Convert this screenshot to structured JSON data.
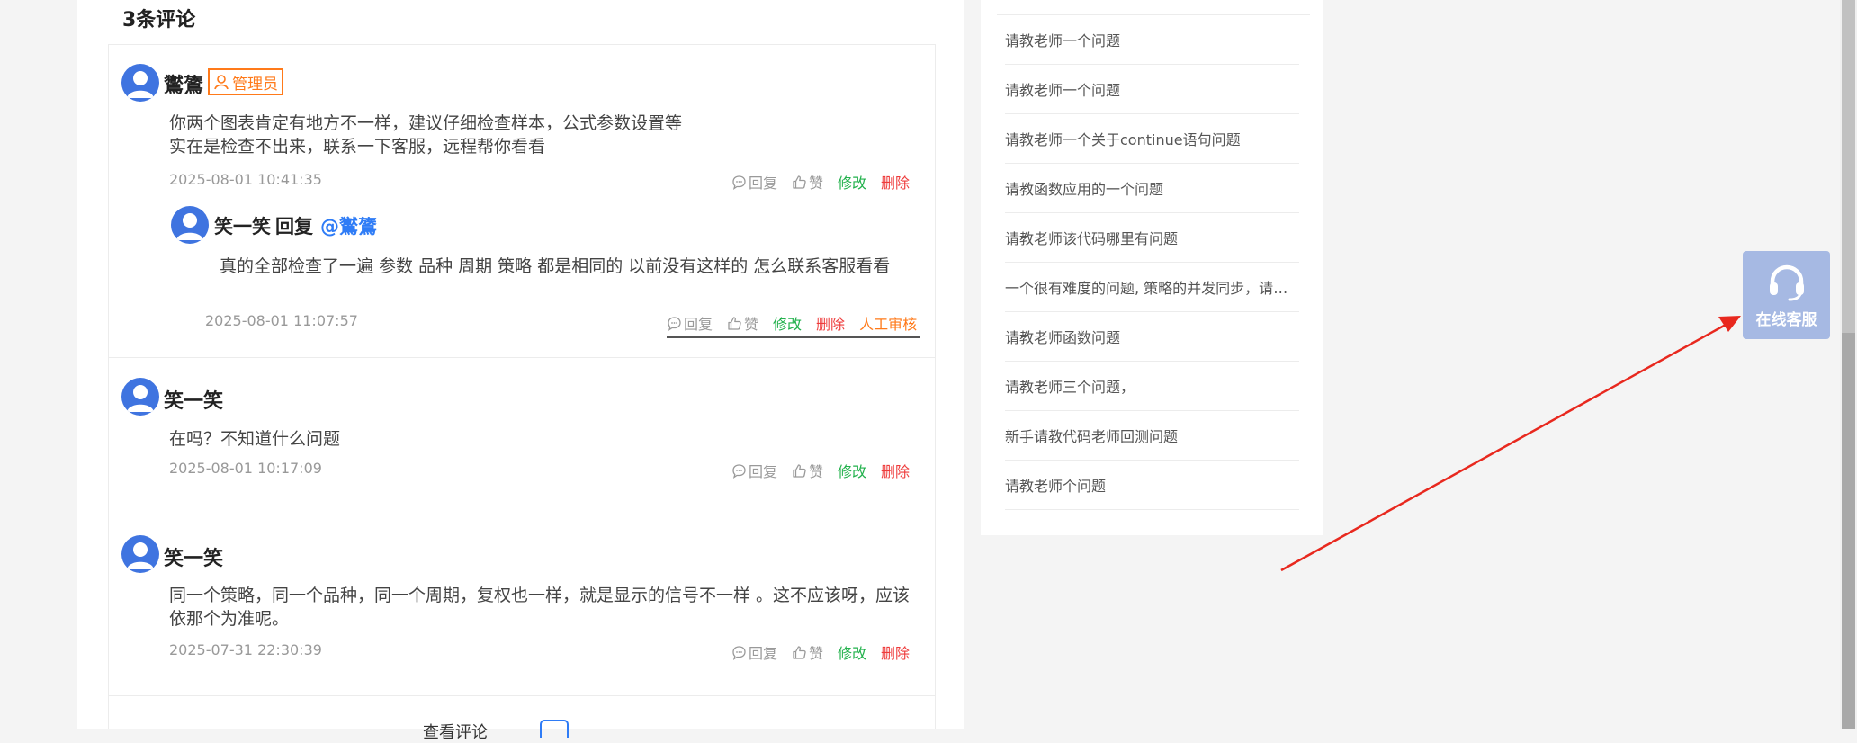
{
  "comments": {
    "title": "3条评论",
    "actions": {
      "reply": "回复",
      "like": "赞",
      "edit": "修改",
      "delete": "删除",
      "audit": "人工审核"
    },
    "items": [
      {
        "user": "鸑鷟",
        "badge": "管理员",
        "lines": [
          "你两个图表肯定有地方不一样，建议仔细检查样本，公式参数设置等",
          "实在是检查不出来，联系一下客服，远程帮你看看"
        ],
        "time": "2025-08-01 10:41:35",
        "reply": {
          "user": "笑一笑",
          "reply_word": "回复",
          "mention": "@鸑鷟",
          "text": "真的全部检查了一遍   参数  品种  周期  策略  都是相同的   以前没有这样的    怎么联系客服看看",
          "time": "2025-08-01 11:07:57"
        }
      },
      {
        "user": "笑一笑",
        "lines": [
          "在吗？不知道什么问题"
        ],
        "time": "2025-08-01 10:17:09"
      },
      {
        "user": "笑一笑",
        "text": "同一个策略，同一个品种，同一个周期，复权也一样，就是显示的信号不一样 。这不应该呀，应该依那个为准呢。",
        "time": "2025-07-31 22:30:39"
      }
    ],
    "more": "查看评论"
  },
  "sidebar": {
    "items": [
      "请教老师一个问题",
      "请教老师一个问题",
      "请教老师一个关于continue语句问题",
      "请教函数应用的一个问题",
      "请教老师该代码哪里有问题",
      "一个很有难度的问题, 策略的并发同步，请教老师",
      "请教老师函数问题",
      "请教老师三个问题，",
      "新手请教代码老师回测问题",
      "请教老师个问题"
    ]
  },
  "float_service": {
    "label": "在线客服",
    "icon": "headset-icon"
  },
  "colors": {
    "accent": "#2f7cf6",
    "admin": "#ff7a1a",
    "edit": "#22b14c",
    "delete": "#ee3b3b",
    "service": "#a6b9e3",
    "arrow": "#e8281e"
  }
}
